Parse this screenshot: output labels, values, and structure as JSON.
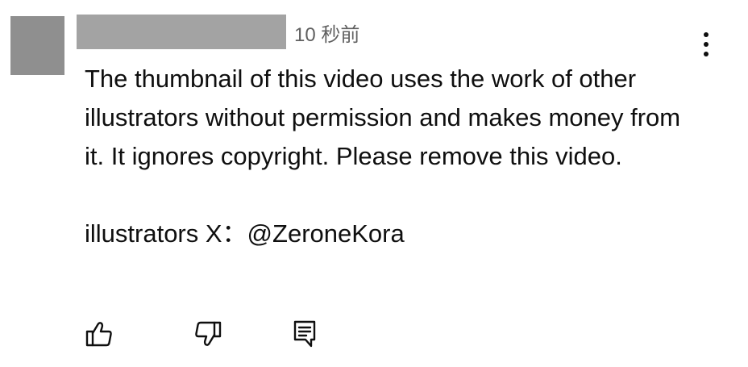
{
  "comment": {
    "timestamp": "10 秒前",
    "text_paragraph_1": "The thumbnail of this video uses the work of other illustrators without permission and makes money from it. It ignores copyright. Please remove this video.",
    "text_paragraph_2": "illustrators X：@ZeroneKora"
  },
  "actions": {
    "like_icon": "thumbs-up-outline",
    "dislike_icon": "thumbs-down-outline",
    "reply_icon": "comment-reply"
  },
  "colors": {
    "avatar_redacted": "#8f8f8f",
    "username_redacted": "#a3a3a3",
    "timestamp": "#606060",
    "text": "#0f0f0f"
  }
}
